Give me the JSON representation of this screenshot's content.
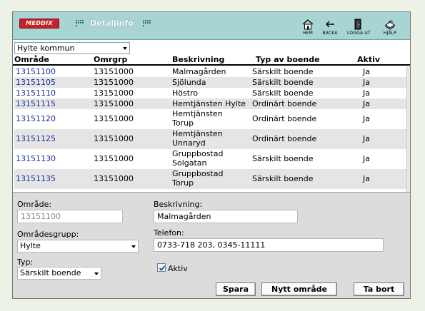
{
  "header": {
    "logo": "MEDDIX",
    "title": "Detaljinfo",
    "toolbar": [
      {
        "label": "HEM",
        "icon": "home-icon"
      },
      {
        "label": "BACKA",
        "icon": "back-arrow-icon"
      },
      {
        "label": "LOGGA UT",
        "icon": "door-icon"
      },
      {
        "label": "HJÄLP",
        "icon": "book-icon"
      }
    ]
  },
  "area_select": {
    "value": "Hylte kommun"
  },
  "table": {
    "columns": [
      "Område",
      "Omrgrp",
      "Beskrivning",
      "Typ av boende",
      "Aktiv"
    ],
    "rows": [
      {
        "omrade": "13151100",
        "omrgrp": "13151000",
        "besk": [
          "Malmagården"
        ],
        "typ": "Särskilt boende",
        "aktiv": "Ja"
      },
      {
        "omrade": "13151105",
        "omrgrp": "13151000",
        "besk": [
          "Sjölunda"
        ],
        "typ": "Särskilt boende",
        "aktiv": "Ja"
      },
      {
        "omrade": "13151110",
        "omrgrp": "13151000",
        "besk": [
          "Höstro"
        ],
        "typ": "Särskilt boende",
        "aktiv": "Ja"
      },
      {
        "omrade": "13151115",
        "omrgrp": "13151000",
        "besk": [
          "Hemtjänsten Hylte"
        ],
        "typ": "Ordinärt boende",
        "aktiv": "Ja"
      },
      {
        "omrade": "13151120",
        "omrgrp": "13151000",
        "besk": [
          "Hemtjänsten",
          "Torup"
        ],
        "typ": "Ordinärt boende",
        "aktiv": "Ja"
      },
      {
        "omrade": "13151125",
        "omrgrp": "13151000",
        "besk": [
          "Hemtjänsten",
          "Unnaryd"
        ],
        "typ": "Ordinärt boende",
        "aktiv": "Ja"
      },
      {
        "omrade": "13151130",
        "omrgrp": "13151000",
        "besk": [
          "Gruppbostad",
          "Solgatan"
        ],
        "typ": "Särskilt boende",
        "aktiv": "Ja"
      },
      {
        "omrade": "13151135",
        "omrgrp": "13151000",
        "besk": [
          "Gruppbostad",
          "Torup"
        ],
        "typ": "Särskilt boende",
        "aktiv": "Ja"
      }
    ]
  },
  "form": {
    "omrade_label": "Område:",
    "omrade_value": "13151100",
    "beskrivning_label": "Beskrivning:",
    "beskrivning_value": "Malmagården",
    "omradesgrupp_label": "Områdesgrupp:",
    "omradesgrupp_value": "Hylte",
    "telefon_label": "Telefon:",
    "telefon_value": "0733-718 203, 0345-11111",
    "typ_label": "Typ:",
    "typ_value": "Särskilt boende",
    "aktiv_label": "Aktiv",
    "aktiv_checked": true,
    "buttons": {
      "spara": "Spara",
      "nytt": "Nytt område",
      "tabort": "Ta bort"
    }
  }
}
